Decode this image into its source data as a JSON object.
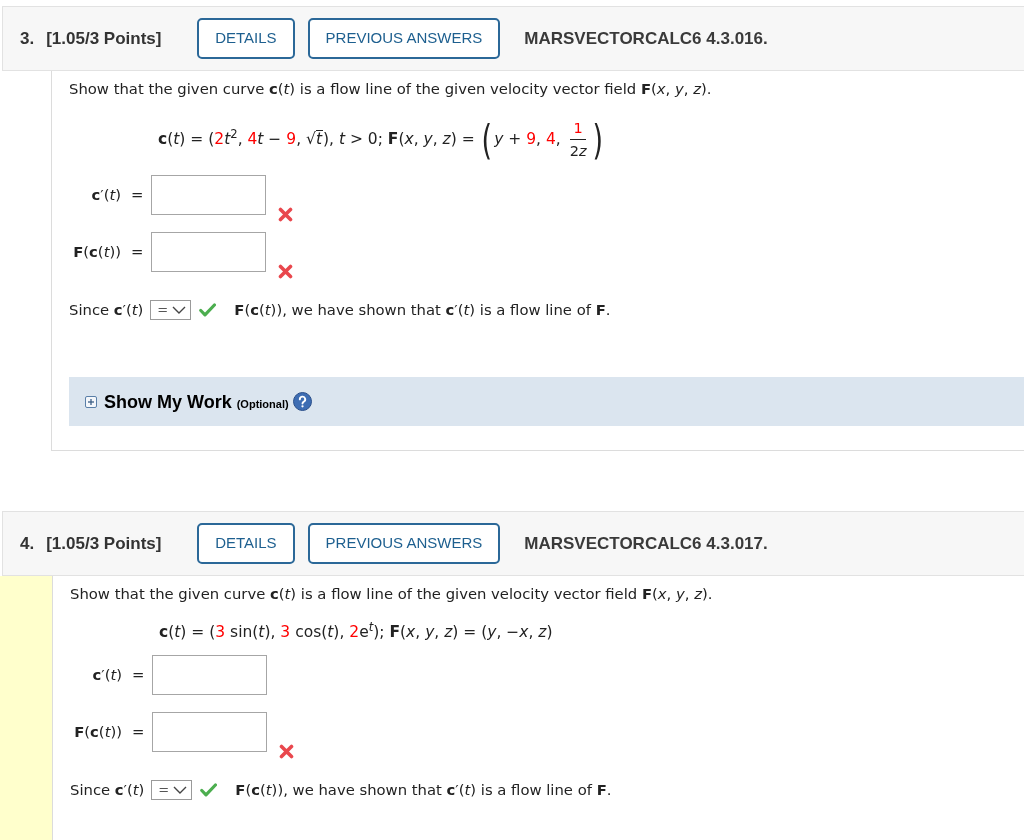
{
  "questions": [
    {
      "number": "3.",
      "points": "[1.05/3 Points]",
      "buttons": [
        "DETAILS",
        "PREVIOUS ANSWERS"
      ],
      "code": "MARSVECTORCALC6 4.3.016.",
      "highlighted": false,
      "prompt": "Show that the given curve **c**(*t*) is a flow line of the given velocity vector field **F**(*x*, *y*, *z*).",
      "formula": [
        {
          "kind": "text",
          "text": "**c**(*t*) = ("
        },
        {
          "kind": "value",
          "text": "2"
        },
        {
          "kind": "text",
          "text": "*t*$^{2}$, "
        },
        {
          "kind": "value",
          "text": "4"
        },
        {
          "kind": "text",
          "text": "*t* − "
        },
        {
          "kind": "value",
          "text": "9"
        },
        {
          "kind": "text",
          "text": ", "
        },
        {
          "kind": "sqrt",
          "symbol": "√",
          "radicand": [
            {
              "kind": "text",
              "text": "*t*"
            }
          ]
        },
        {
          "kind": "text",
          "text": "), *t* > 0; **F**(*x*, *y*, *z*) = "
        },
        {
          "kind": "paren",
          "text": "("
        },
        {
          "kind": "text",
          "text": "*y* + "
        },
        {
          "kind": "value",
          "text": "9"
        },
        {
          "kind": "text",
          "text": ", "
        },
        {
          "kind": "value",
          "text": "4"
        },
        {
          "kind": "text",
          "text": ", "
        },
        {
          "kind": "fraction",
          "numerator": [
            {
              "kind": "value",
              "text": "1"
            }
          ],
          "denominator": [
            {
              "kind": "text",
              "text": "2"
            },
            {
              "kind": "text",
              "text": "*z*"
            }
          ]
        },
        {
          "kind": "paren",
          "text": ")"
        }
      ],
      "answers": [
        {
          "label": "**c**′(*t*)",
          "relation": "=",
          "marked_incorrect": true
        },
        {
          "label": "**F**(**c**(*t*))",
          "relation": "=",
          "marked_incorrect": true
        }
      ],
      "conclusion": {
        "before": "Since **c**′(*t*)",
        "select": "=",
        "correct": true,
        "after": "**F**(**c**(*t*)), we have shown that **c**′(*t*) is a flow line of **F**."
      },
      "show_my_work": {
        "title": "Show My Work",
        "note": "(Optional)",
        "expanded": false
      }
    },
    {
      "number": "4.",
      "points": "[1.05/3 Points]",
      "buttons": [
        "DETAILS",
        "PREVIOUS ANSWERS"
      ],
      "code": "MARSVECTORCALC6 4.3.017.",
      "highlighted": true,
      "prompt": "Show that the given curve **c**(*t*) is a flow line of the given velocity vector field **F**(*x*, *y*, *z*).",
      "formula": [
        {
          "kind": "text",
          "text": "**c**(*t*) = ("
        },
        {
          "kind": "value",
          "text": "3"
        },
        {
          "kind": "text",
          "text": " sin(*t*), "
        },
        {
          "kind": "value",
          "text": "3"
        },
        {
          "kind": "text",
          "text": " cos(*t*), "
        },
        {
          "kind": "value",
          "text": "2"
        },
        {
          "kind": "power",
          "base": "e",
          "exponent": "*t*"
        },
        {
          "kind": "text",
          "text": "); **F**(*x*, *y*, *z*) = (*y*, −*x*, *z*)"
        }
      ],
      "answers": [
        {
          "label": "**c**′(*t*)",
          "relation": "=",
          "marked_incorrect": false
        },
        {
          "label": "**F**(**c**(*t*))",
          "relation": "=",
          "marked_incorrect": true
        }
      ],
      "conclusion": {
        "before": "Since **c**′(*t*)",
        "select": "=",
        "correct": true,
        "after": "**F**(**c**(*t*)), we have shown that **c**′(*t*) is a flow line of **F**."
      }
    }
  ]
}
